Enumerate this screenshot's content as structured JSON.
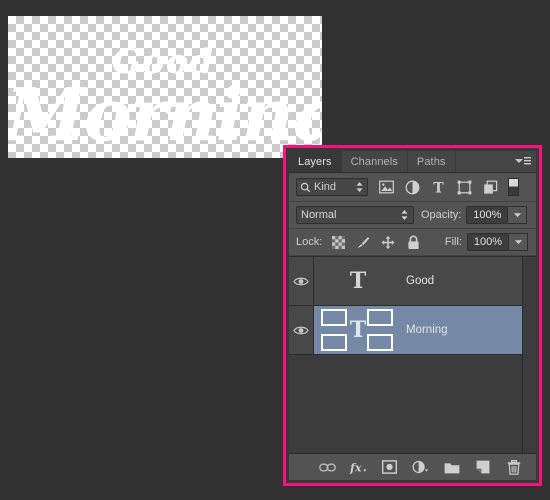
{
  "canvas": {
    "text_line1": "Good",
    "text_line2": "Morning",
    "background": "transparent-checkerboard"
  },
  "panel": {
    "highlight_color": "#f5137f",
    "tabs": [
      {
        "label": "Layers",
        "active": true
      },
      {
        "label": "Channels",
        "active": false
      },
      {
        "label": "Paths",
        "active": false
      }
    ],
    "menu_icon": "panel-menu-icon",
    "filter": {
      "kind_label": "Kind",
      "search_icon": "magnifier-icon",
      "icons": [
        "pixel-layer-filter-icon",
        "adjustment-layer-filter-icon",
        "type-layer-filter-icon",
        "shape-layer-filter-icon",
        "smart-object-filter-icon"
      ],
      "toggle": "filter-enable-toggle"
    },
    "blend": {
      "mode": "Normal",
      "opacity_label": "Opacity:",
      "opacity_value": "100%"
    },
    "lock": {
      "label": "Lock:",
      "icons": [
        "lock-transparency-icon",
        "lock-image-pixels-icon",
        "lock-position-icon",
        "lock-all-icon"
      ],
      "fill_label": "Fill:",
      "fill_value": "100%"
    },
    "layers": [
      {
        "name": "Good",
        "thumb": "T",
        "visible": true,
        "selected": false
      },
      {
        "name": "Morning",
        "thumb": "T",
        "visible": true,
        "selected": true
      }
    ],
    "bottom_bar": {
      "icons": [
        "link-layers-icon",
        "layer-style-fx-icon",
        "add-layer-mask-icon",
        "new-adjustment-layer-icon",
        "new-group-icon",
        "new-layer-icon",
        "delete-layer-icon"
      ]
    }
  }
}
